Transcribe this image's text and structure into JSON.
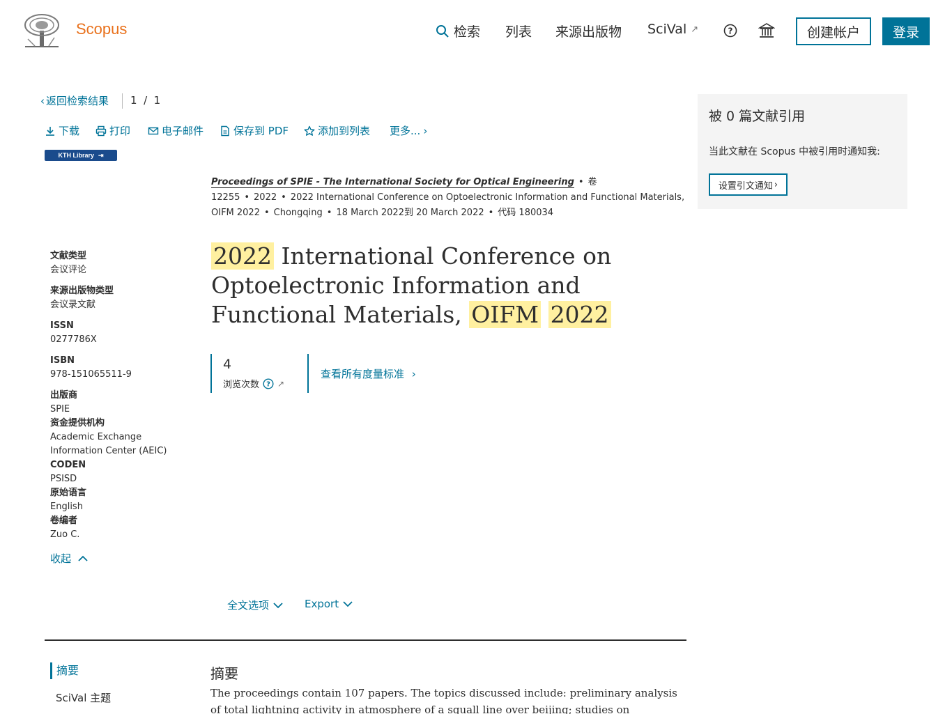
{
  "header": {
    "brand": "Scopus",
    "nav": {
      "search": "检索",
      "lists": "列表",
      "sources": "来源出版物",
      "scival": "SciVal"
    },
    "create_account": "创建帐户",
    "sign_in": "登录"
  },
  "back_bar": {
    "back_label": "返回检索结果",
    "pager": "1  /  1"
  },
  "toolbar": {
    "download": "下载",
    "print": "打印",
    "email": "电子邮件",
    "save_pdf": "保存到 PDF",
    "add_to_list": "添加到列表",
    "more": "更多..."
  },
  "kth_badge": "KTH Library",
  "source": {
    "title": "Proceedings of SPIE - The International Society for Optical Engineering",
    "volume": "卷 12255",
    "year": "2022",
    "conference": "2022 International Conference on Optoelectronic Information and Functional Materials, OIFM 2022",
    "location": "Chongqing",
    "dates": "18 March 2022到 20 March 2022",
    "code": "代码 180034"
  },
  "title_parts": {
    "p1": "2022",
    "p2": " International Conference on Optoelectronic Information and Functional Materials, ",
    "p3": "OIFM",
    "p4": " ",
    "p5": "2022"
  },
  "metrics": {
    "views_count": "4",
    "views_label": "浏览次数",
    "see_all": "查看所有度量标准"
  },
  "meta": {
    "doc_type_key": "文献类型",
    "doc_type_val": "会议评论",
    "source_type_key": "来源出版物类型",
    "source_type_val": "会议录文献",
    "issn_key": "ISSN",
    "issn_val": "0277786X",
    "isbn_key": "ISBN",
    "isbn_val": "978-151065511-9",
    "publisher_key": "出版商",
    "publisher_val": "SPIE",
    "funding_key": "资金提供机构",
    "funding_val": "Academic Exchange Information Center (AEIC)",
    "coden_key": "CODEN",
    "coden_val": "PSISD",
    "language_key": "原始语言",
    "language_val": "English",
    "editor_key": "卷编者",
    "editor_val": "Zuo C.",
    "collapse": "收起"
  },
  "options": {
    "full_text": "全文选项",
    "export": "Export"
  },
  "abstract_nav": {
    "abstract": "摘要",
    "scival_topics": "SciVal 主题"
  },
  "abstract": {
    "heading": "摘要",
    "text": "The proceedings contain 107 papers. The topics discussed include: preliminary analysis of total lightning activity in atmosphere of a squall line over beijing; studies on calibration of"
  },
  "cite_panel": {
    "title": "被 0 篇文献引用",
    "notify": "当此文献在 Scopus 中被引用时通知我:",
    "alert_button": "设置引文通知"
  },
  "colors": {
    "accent": "#007398",
    "brand": "#e9711c",
    "highlight": "#fff0a0"
  }
}
